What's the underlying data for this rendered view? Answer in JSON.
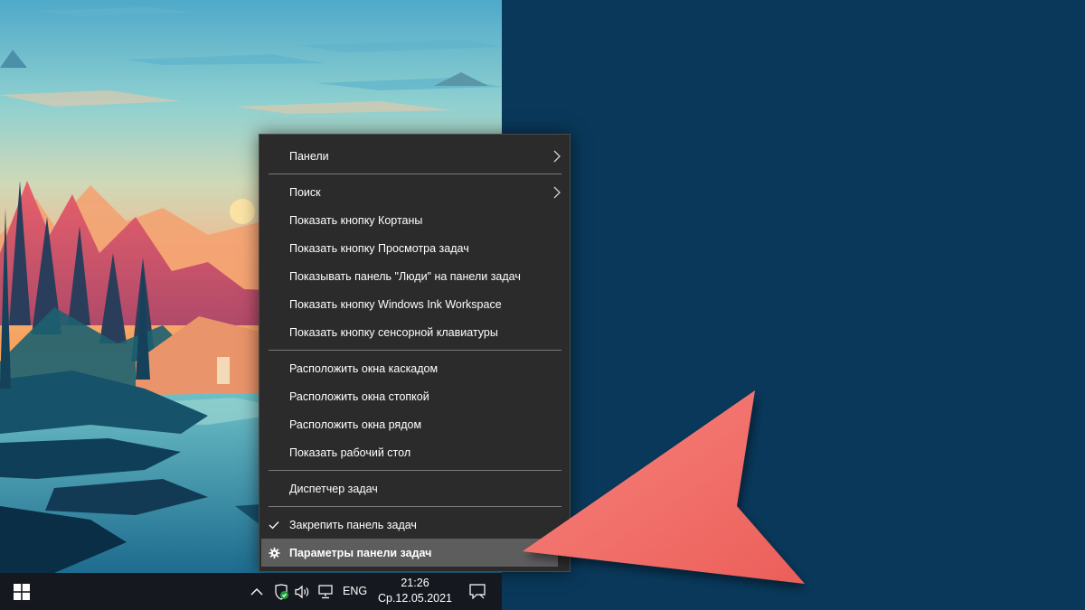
{
  "context_menu": {
    "items": [
      {
        "label": "Панели",
        "submenu": true
      },
      {
        "label": "Поиск",
        "submenu": true
      },
      {
        "label": "Показать кнопку Кортаны"
      },
      {
        "label": "Показать кнопку Просмотра задач"
      },
      {
        "label": "Показывать панель \"Люди\" на панели задач"
      },
      {
        "label": "Показать кнопку Windows Ink Workspace"
      },
      {
        "label": "Показать кнопку сенсорной клавиатуры"
      },
      {
        "label": "Расположить окна каскадом"
      },
      {
        "label": "Расположить окна стопкой"
      },
      {
        "label": "Расположить окна рядом"
      },
      {
        "label": "Показать рабочий стол"
      },
      {
        "label": "Диспетчер задач"
      },
      {
        "label": "Закрепить панель задач",
        "checked": true
      },
      {
        "label": "Параметры панели задач",
        "icon": "gear-icon",
        "highlighted": true
      }
    ]
  },
  "taskbar": {
    "language": "ENG",
    "time": "21:26",
    "date": "Ср.12.05.2021",
    "tray_icons": [
      "chevron-up-icon",
      "defender-shield-icon",
      "volume-icon",
      "network-icon"
    ],
    "notification_icon": "action-center-icon",
    "start_icon": "windows-logo-icon"
  },
  "colors": {
    "background": "#09385a",
    "menu_bg": "#2b2b2b",
    "menu_highlight": "#5d5d5d",
    "taskbar_bg": "#15191f",
    "arrow": "#f2706a"
  }
}
